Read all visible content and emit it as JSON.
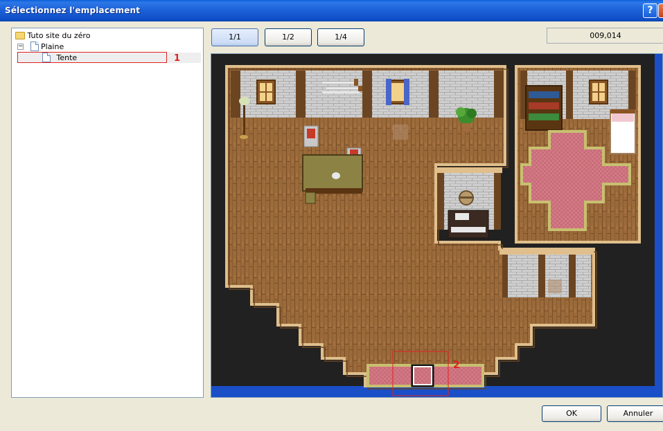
{
  "window": {
    "title": "Sélectionnez l'emplacement",
    "help_label": "?",
    "close_label": "✕"
  },
  "tree": {
    "root": {
      "label": "Tuto site du zéro",
      "icon": "folder-icon"
    },
    "child": {
      "label": "Plaine",
      "icon": "document-icon",
      "expander": "−"
    },
    "grandchild": {
      "label": "Tente",
      "icon": "document-icon"
    }
  },
  "annotations": {
    "tree_marker": "1",
    "map_marker": "2",
    "color": "#e02020"
  },
  "zoom": {
    "buttons": [
      "1/1",
      "1/2",
      "1/4"
    ],
    "selected": "1/1"
  },
  "coordinates": "009,014",
  "dialog": {
    "ok_label": "OK",
    "cancel_label": "Annuler"
  },
  "colors": {
    "titlebar": "#0e4fc8",
    "wood_floor": "#9a6a3a",
    "wall": "#c8c8c8",
    "void": "#212121",
    "carpet": "#d27a86",
    "accent_blue": "#1b4fc8"
  }
}
